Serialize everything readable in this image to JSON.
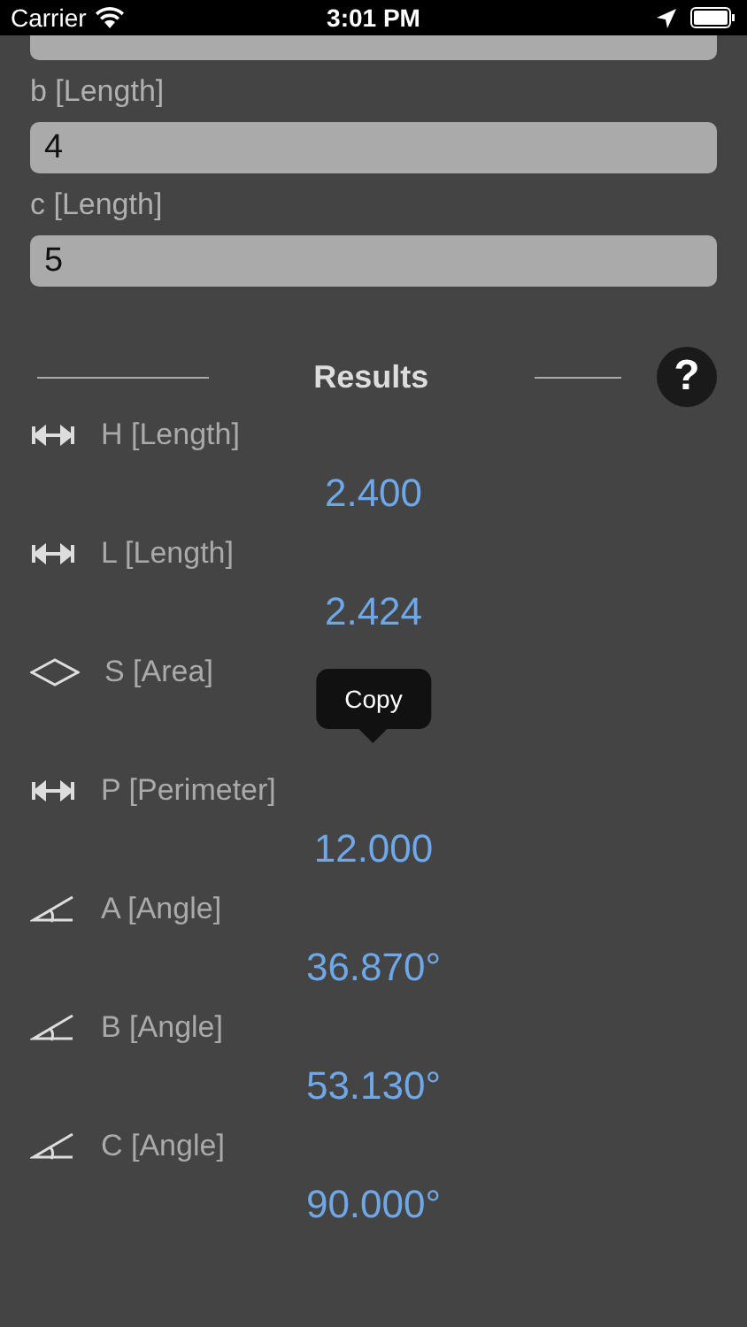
{
  "status_bar": {
    "carrier": "Carrier",
    "time": "3:01 PM"
  },
  "inputs": [
    {
      "kind": "cut"
    },
    {
      "kind": "full",
      "label": "b [Length]",
      "value": "4"
    },
    {
      "kind": "full",
      "label": "c [Length]",
      "value": "5"
    }
  ],
  "results_header": {
    "title": "Results",
    "help": "?"
  },
  "results": [
    {
      "kind": "length",
      "label": "H [Length]",
      "value": "2.400"
    },
    {
      "kind": "length",
      "label": "L [Length]",
      "value": "2.424"
    },
    {
      "kind": "area",
      "label": "S [Area]",
      "tooltip": "Copy"
    },
    {
      "kind": "length",
      "label": "P [Perimeter]",
      "value": "12.000"
    },
    {
      "kind": "angle",
      "label": "A [Angle]",
      "value": "36.870°"
    },
    {
      "kind": "angle",
      "label": "B [Angle]",
      "value": "53.130°"
    },
    {
      "kind": "angle",
      "label": "C [Angle]",
      "value": "90.000°"
    }
  ]
}
